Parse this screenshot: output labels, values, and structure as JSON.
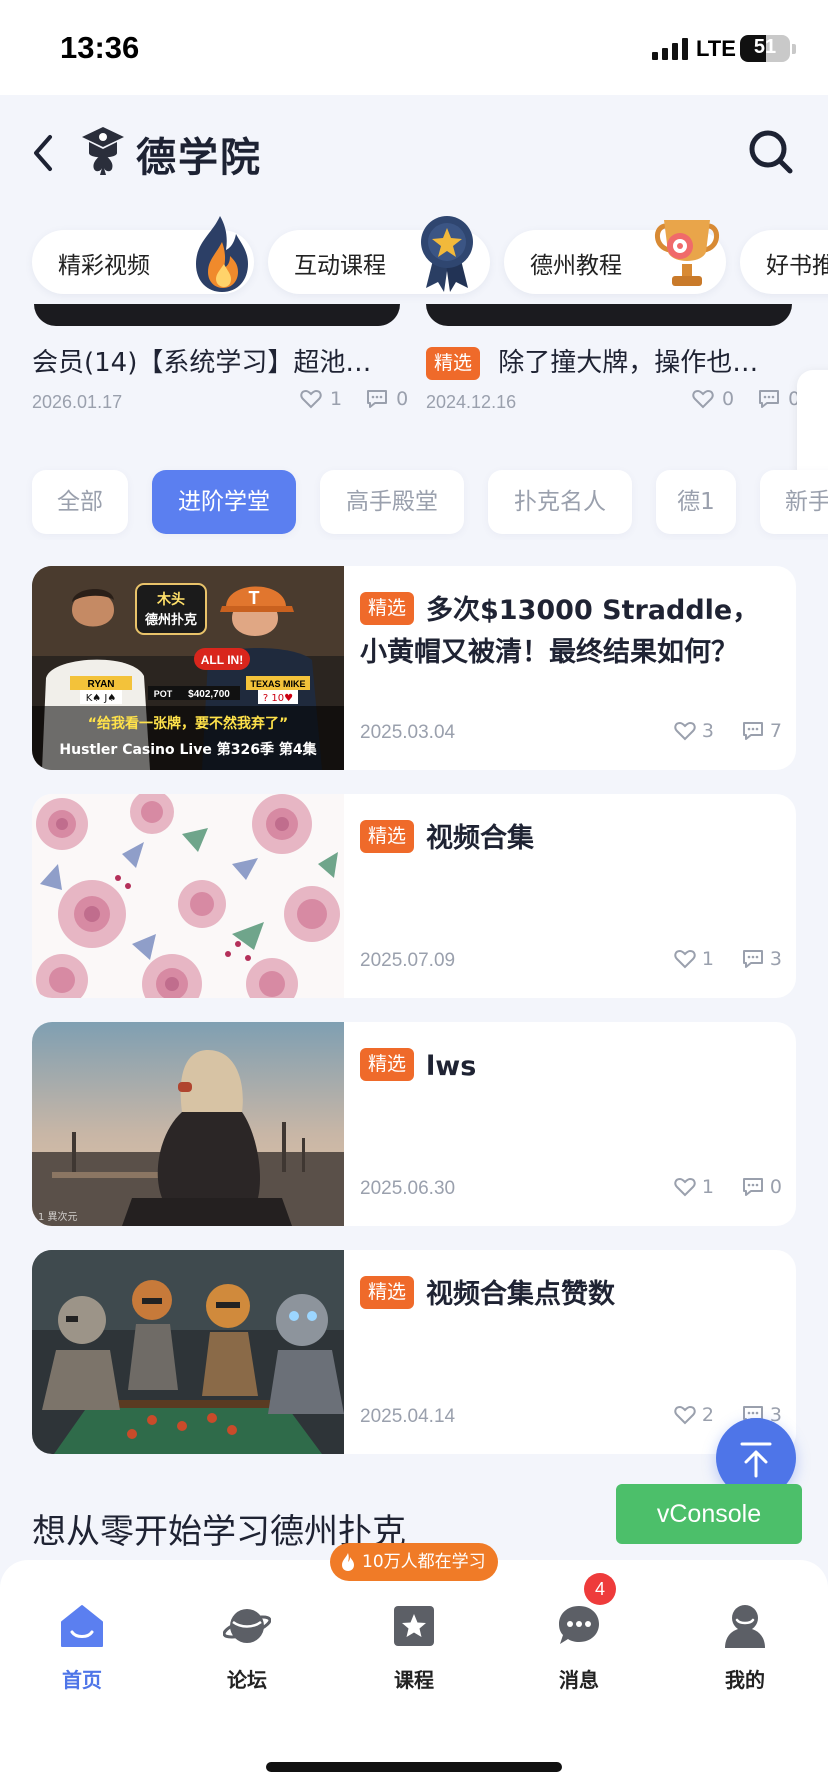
{
  "status": {
    "time": "13:36",
    "network": "LTE",
    "battery": "51",
    "battery_level": 0.51
  },
  "header": {
    "title": "德学院"
  },
  "categories": [
    {
      "label": "精彩视频",
      "icon": "flame-icon"
    },
    {
      "label": "互动课程",
      "icon": "medal-icon"
    },
    {
      "label": "德州教程",
      "icon": "trophy-icon"
    },
    {
      "label": "好书推"
    }
  ],
  "featured": [
    {
      "title": "会员(14)【系统学习】超池…",
      "date": "2026.01.17",
      "likes": "1",
      "comments": "0"
    },
    {
      "badge": "精选",
      "title": "除了撞大牌，操作也…",
      "date": "2024.12.16",
      "likes": "0",
      "comments": "0"
    }
  ],
  "tabs": [
    "全部",
    "进阶学堂",
    "高手殿堂",
    "扑克名人",
    "德1",
    "新手"
  ],
  "active_tab": "进阶学堂",
  "videos": [
    {
      "badge": "精选",
      "title": "多次$13000 Straddle，小黄帽又被清！最终结果如何？H…",
      "date": "2025.03.04",
      "likes": "3",
      "comments": "7",
      "thumb": {
        "show_logo_top": "木头",
        "show_logo_bottom": "德州扑克",
        "allin": "ALL IN!",
        "player_left": "RYAN",
        "player_right": "TEXAS MIKE",
        "pot_label": "POT",
        "pot_value": "$402,700",
        "cards_left": "K♠ J♠",
        "cards_right": "? 10♥",
        "subtitle": "“给我看一张牌，要不然我弃了”",
        "caption": "Hustler Casino Live 第326季 第4集",
        "hat_letter": "T"
      }
    },
    {
      "badge": "精选",
      "title": "视频合集",
      "date": "2025.07.09",
      "likes": "1",
      "comments": "3"
    },
    {
      "badge": "精选",
      "title": "lws",
      "date": "2025.06.30",
      "likes": "1",
      "comments": "0",
      "thumb_watermark": "1 異次元"
    },
    {
      "badge": "精选",
      "title": "视频合集点赞数",
      "date": "2025.04.14",
      "likes": "2",
      "comments": "3"
    }
  ],
  "section_heading": "想从零开始学习德州扑克",
  "vconsole": "vConsole",
  "learning_pill": "10万人都在学习",
  "nav": [
    {
      "label": "首页",
      "icon": "home-icon"
    },
    {
      "label": "论坛",
      "icon": "planet-icon"
    },
    {
      "label": "课程",
      "icon": "course-star-icon"
    },
    {
      "label": "消息",
      "icon": "chat-icon",
      "badge": "4"
    },
    {
      "label": "我的",
      "icon": "profile-icon"
    }
  ],
  "colors": {
    "accent": "#5b7ff0",
    "badge": "#ef6a2a",
    "vconsole": "#4cbf6a",
    "unread": "#ee3b3b"
  }
}
